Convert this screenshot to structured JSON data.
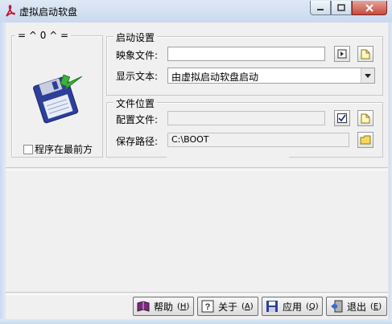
{
  "window": {
    "title": "虚拟启动软盘"
  },
  "left_panel": {
    "legend": "= ^ 0 ^ =",
    "always_on_top_label": "程序在最前方",
    "always_on_top_checked": false
  },
  "startup_group": {
    "legend": "启动设置",
    "image_file_label": "映象文件:",
    "image_file_value": "",
    "display_text_label": "显示文本:",
    "display_text_value": "由虚拟启动软盘启动"
  },
  "file_group": {
    "legend": "文件位置",
    "config_file_label": "配置文件:",
    "config_file_value": "",
    "save_path_label": "保存路径:",
    "save_path_value": "C:\\BOOT"
  },
  "buttons": {
    "help": "帮助",
    "help_key": "H",
    "about": "关于",
    "about_key": "A",
    "apply": "应用",
    "apply_key": "Q",
    "exit": "退出",
    "exit_key": "E"
  },
  "colors": {
    "accent": "#3a6ea5",
    "floppy": "#2d3f9a",
    "arrow": "#3bb23b"
  },
  "icons": [
    "pdf-app-icon",
    "floppy-disk-icon",
    "browse-icon",
    "folder-icon",
    "checkmark-icon",
    "book-icon",
    "question-icon",
    "save-icon",
    "exit-door-icon"
  ]
}
